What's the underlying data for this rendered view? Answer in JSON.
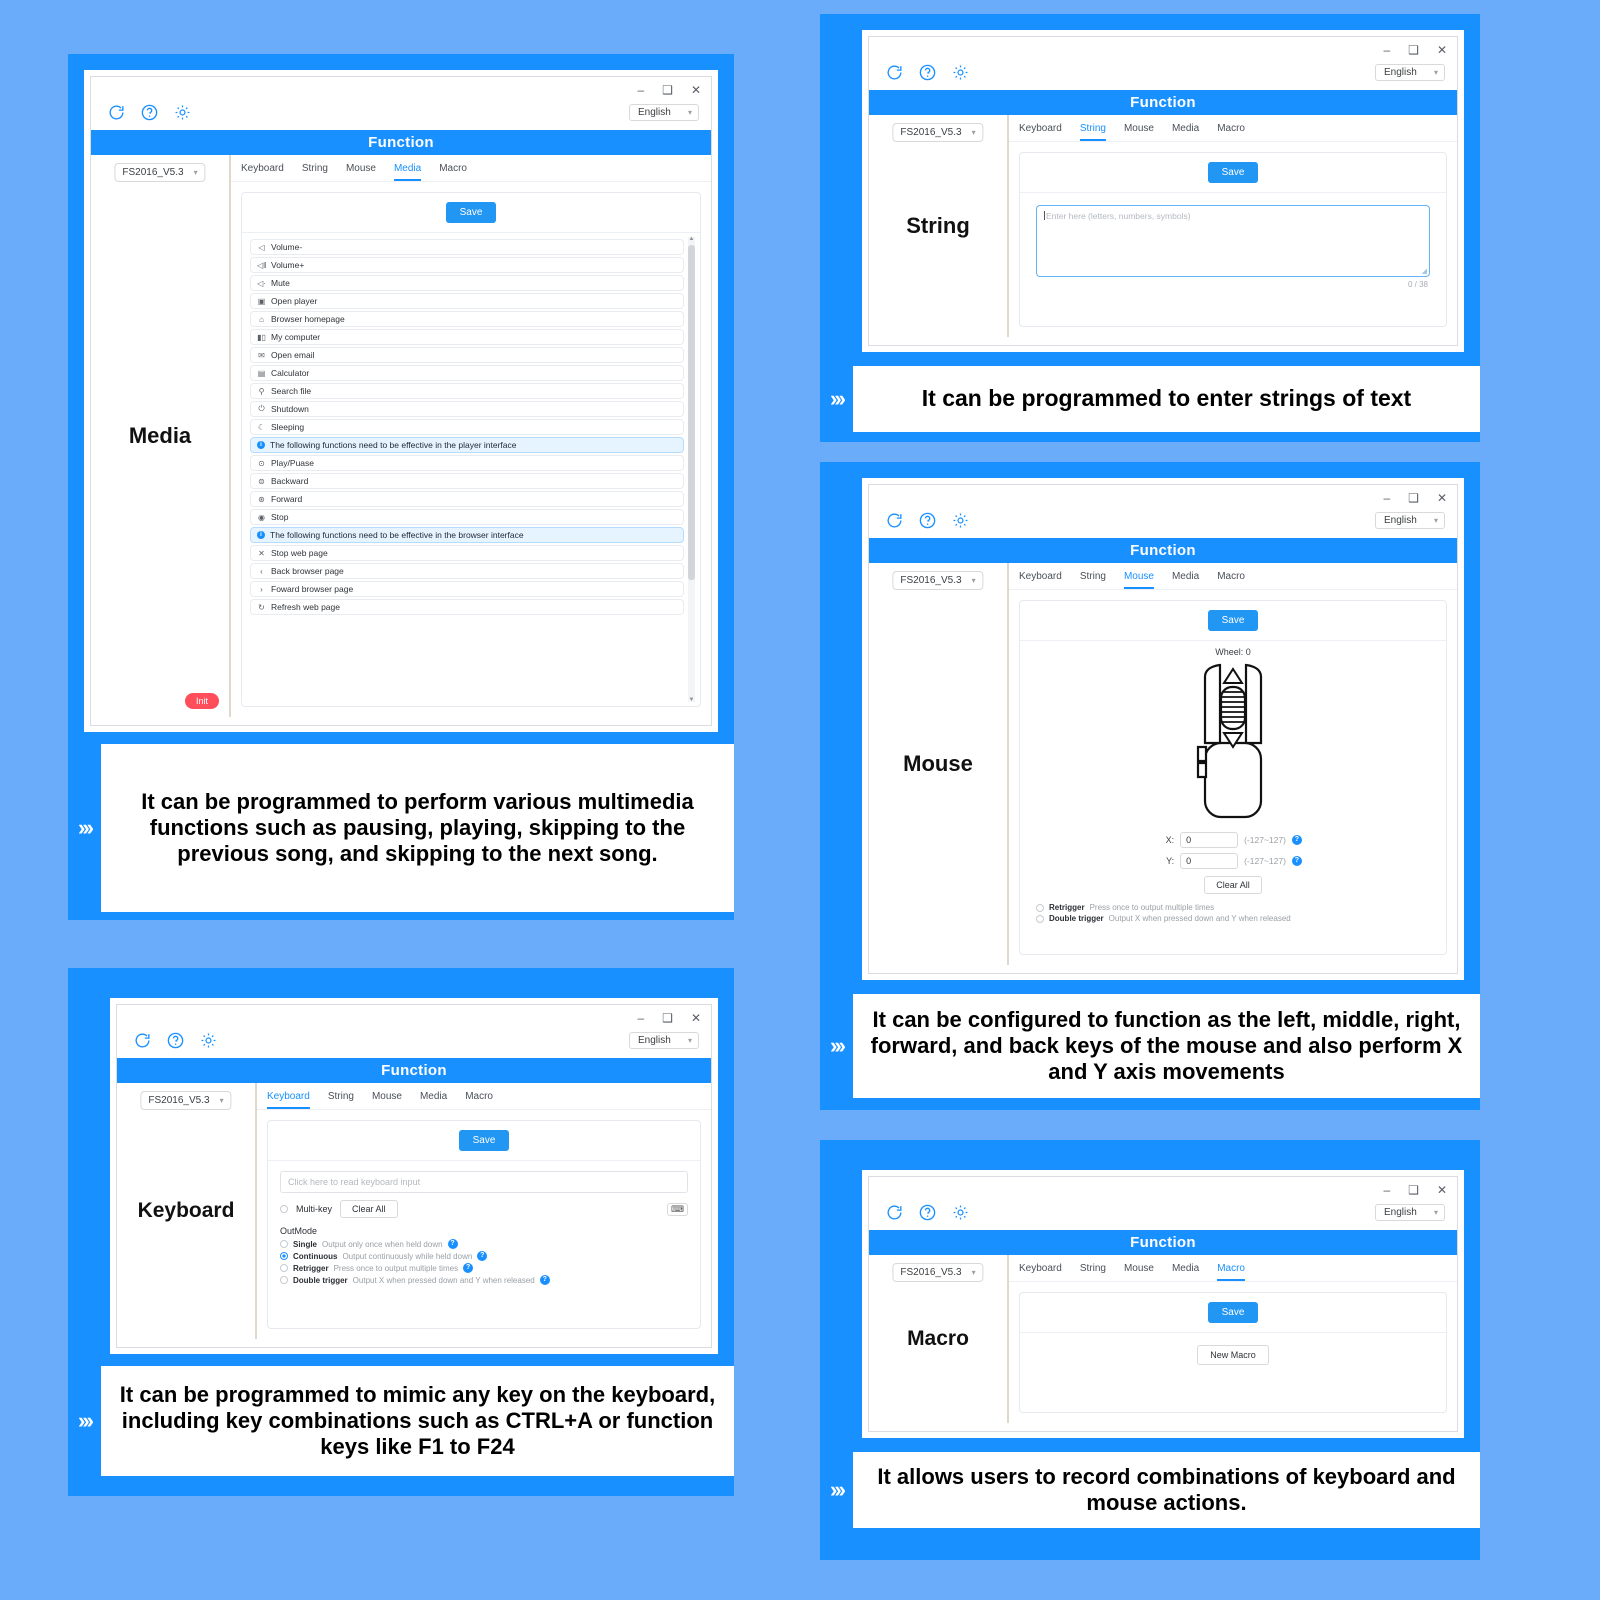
{
  "common": {
    "window_controls": {
      "minimize": "–",
      "maximize": "❑",
      "close": "✕"
    },
    "language": "English",
    "device": "FS2016_V5.3",
    "function_title": "Function",
    "save_label": "Save",
    "tabs": [
      "Keyboard",
      "String",
      "Mouse",
      "Media",
      "Macro"
    ],
    "icons": {
      "refresh": "refresh-icon",
      "help": "help-circle-icon",
      "settings": "gear-icon"
    }
  },
  "cards": {
    "media": {
      "label": "Media",
      "active_tab": "Media",
      "init_label": "Init",
      "items": [
        {
          "icon": "ὐA",
          "glyph": "◁",
          "label": "Volume-"
        },
        {
          "icon": "volume-up-icon",
          "glyph": "◁‖",
          "label": "Volume+"
        },
        {
          "icon": "mute-icon",
          "glyph": "◁·",
          "label": "Mute"
        },
        {
          "icon": "player-icon",
          "glyph": "▣",
          "label": "Open player"
        },
        {
          "icon": "home-icon",
          "glyph": "⌂",
          "label": "Browser homepage"
        },
        {
          "icon": "computer-icon",
          "glyph": "▮▯",
          "label": "My computer"
        },
        {
          "icon": "mail-icon",
          "glyph": "✉",
          "label": "Open email"
        },
        {
          "icon": "calculator-icon",
          "glyph": "▤",
          "label": "Calculator"
        },
        {
          "icon": "search-icon",
          "glyph": "⚲",
          "label": "Search file"
        },
        {
          "icon": "power-icon",
          "glyph": "⏻",
          "label": "Shutdown"
        },
        {
          "icon": "moon-icon",
          "glyph": "☾",
          "label": "Sleeping"
        },
        {
          "icon": "info-icon",
          "glyph": "i",
          "label": "The following functions need to be effective in the player interface",
          "note": true
        },
        {
          "icon": "play-pause-icon",
          "glyph": "⊙",
          "label": "Play/Puase"
        },
        {
          "icon": "backward-icon",
          "glyph": "⊜",
          "label": "Backward"
        },
        {
          "icon": "forward-icon",
          "glyph": "⊛",
          "label": "Forward"
        },
        {
          "icon": "stop-icon",
          "glyph": "◉",
          "label": "Stop"
        },
        {
          "icon": "info-icon",
          "glyph": "i",
          "label": "The following functions need to be effective in the browser interface",
          "note": true
        },
        {
          "icon": "close-icon",
          "glyph": "✕",
          "label": "Stop web page"
        },
        {
          "icon": "chevron-left-icon",
          "glyph": "‹",
          "label": "Back browser page"
        },
        {
          "icon": "chevron-right-icon",
          "glyph": "›",
          "label": "Foward browser page"
        },
        {
          "icon": "reload-icon",
          "glyph": "↻",
          "label": "Refresh web page"
        }
      ],
      "caption": "It can be programmed to perform various multimedia functions such as pausing, playing, skipping to the previous song, and skipping to the next song."
    },
    "string": {
      "label": "String",
      "active_tab": "String",
      "textarea_placeholder": "Enter here (letters, numbers, symbols)",
      "textarea_value": "",
      "counter": "0 / 38",
      "caption": "It can be programmed to enter strings of text"
    },
    "mouse": {
      "label": "Mouse",
      "active_tab": "Mouse",
      "wheel_label": "Wheel: 0",
      "x_label": "X:",
      "x_value": "0",
      "y_label": "Y:",
      "y_value": "0",
      "range_hint": "(-127~127)",
      "clear_all": "Clear All",
      "options": [
        {
          "name": "Retrigger",
          "desc": "Press once to output multiple times",
          "selected": false
        },
        {
          "name": "Double trigger",
          "desc": "Output X when pressed down and Y when released",
          "selected": false
        }
      ],
      "caption": "It can be configured to function as the left, middle, right, forward, and back keys of the mouse and also perform X and Y axis movements"
    },
    "keyboard": {
      "label": "Keyboard",
      "active_tab": "Keyboard",
      "input_placeholder": "Click here to read keyboard input",
      "multikey_label": "Multi-key",
      "multikey_selected": false,
      "clear_all": "Clear All",
      "keyboard_icon": "keyboard-icon",
      "outmode_label": "OutMode",
      "outmode_options": [
        {
          "name": "Single",
          "desc": "Output only once when held down",
          "selected": false
        },
        {
          "name": "Continuous",
          "desc": "Output continuously while held down",
          "selected": true
        },
        {
          "name": "Retrigger",
          "desc": "Press once to output multiple times",
          "selected": false
        },
        {
          "name": "Double trigger",
          "desc": "Output X when pressed down and Y when released",
          "selected": false
        }
      ],
      "caption": "It can be programmed to mimic any key on the keyboard, including key combinations such as CTRL+A or function keys like F1 to F24"
    },
    "macro": {
      "label": "Macro",
      "active_tab": "Macro",
      "new_macro": "New Macro",
      "caption": "It allows users to record combinations of keyboard and mouse actions."
    }
  },
  "colors": {
    "page_background": "#6bacfa",
    "card_blue": "#1890ff",
    "accent": "#2196f3",
    "init_red": "#ff4d5a",
    "note_background": "#e6f4ff"
  }
}
